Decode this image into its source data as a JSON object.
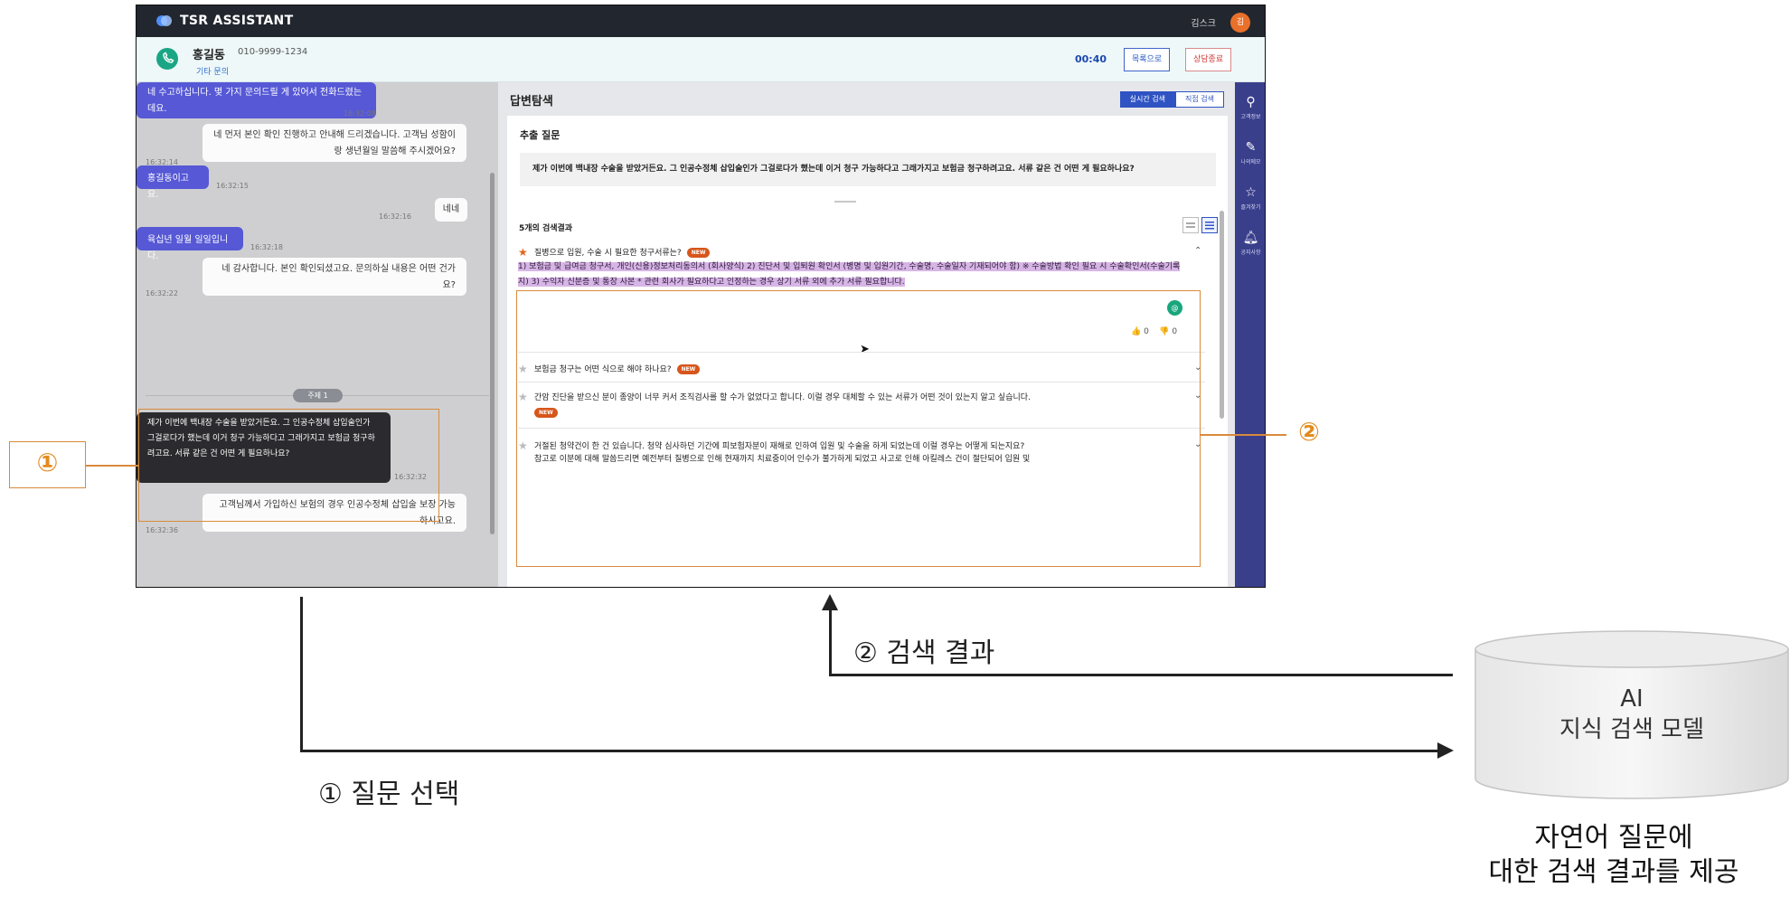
{
  "app": {
    "title": "TSR ASSISTANT",
    "user_name": "김스크",
    "avatar_initial": "김"
  },
  "call": {
    "customer_name": "홍길동",
    "phone": "010-9999-1234",
    "tag": "기타 문의",
    "timer": "00:40",
    "list_button": "목록으로",
    "end_button": "상담종료"
  },
  "chat": {
    "messages": [
      {
        "text": "네 수고하십니다. 몇 가지 문의드릴 게 있어서 전화드렸는데요.",
        "time": "16:32:08"
      },
      {
        "text": "네 먼저 본인 확인 진행하고 안내해 드리겠습니다. 고객님 성함이랑 생년월일 말씀해 주시겠어요?",
        "time": "16:32:14"
      },
      {
        "text": "홍길동이고요.",
        "time": "16:32:15"
      },
      {
        "text": "네네",
        "time": "16:32:16"
      },
      {
        "text": "육십년 일월 일일입니다.",
        "time": "16:32:18"
      },
      {
        "text": "네 감사합니다. 본인 확인되셨고요. 문의하실 내용은 어떤 건가요?",
        "time": "16:32:22"
      },
      {
        "text": "제가 이번에 백내장 수술을 받았거든요. 그 인공수정체 삽입술인가 그걸로다가 했는데 이거 청구 가능하다고 그래가지고 보험금 청구하려고요. 서류 같은 건 어떤 게 필요하나요?",
        "time": "16:32:32"
      },
      {
        "text": "고객님께서 가입하신 보험의 경우 인공수정체 삽입술 보장 가능하시고요.",
        "time": "16:32:36"
      }
    ],
    "topic": "주제 1"
  },
  "search": {
    "title": "답변탐색",
    "tabs": [
      "실시간 검색",
      "직접 검색"
    ],
    "extracted_label": "추출 질문",
    "extracted_question": "제가 이번에 백내장 수술을 받았거든요. 그 인공수정체 삽입술인가 그걸로다가 했는데 이거 청구 가능하다고 그래가지고 보험금 청구하려고요. 서류 같은 건 어떤 게 필요하나요?",
    "result_count": "5개의 검색결과",
    "results": [
      {
        "title": "질병으로 입원, 수술 시 필요한 청구서류는?",
        "new": "NEW"
      },
      {
        "title": "보험금 청구는 어떤 식으로 해야 하나요?",
        "new": "NEW"
      },
      {
        "title": "간암 진단을 받으신 분이 종양이 너무 커서 조직검사를 할 수가 없었다고 합니다. 이럴 경우 대체할 수 있는 서류가 어떤 것이 있는지 알고 싶습니다.",
        "new": "NEW"
      },
      {
        "title": "거절된 청약건이 한 건 있습니다. 청약 심사하던 기간에 피보험자분이 재해로 인하여 입원 및 수술을 하게 되었는데 이럴 경우는 어떻게 되는지요?",
        "line2": "참고로 이분에 대해 말씀드리면 예전부터 질병으로 인해 현재까지 치료중이어 인수가 불가하게 되었고 사고로 인해 아킬레스 건이 절단되어 입원 및"
      }
    ],
    "answer": "1) 보험금 및 급여금 청구서, 개인(신용)정보처리동의서 (회사양식) 2) 진단서 및 입퇴원 확인서 (병명 및 입원기간, 수술명, 수술일자 기재되어야 함) ※ 수술방법 확인 필요 시 수술확인서(수술기록지) 3) 수익자 신분증 및 통장 사본 * 관련 회사가 필요하다고 인정하는 경우 상기 서류 외에 추가 서류 필요합니다.",
    "likes": "0",
    "dislikes": "0"
  },
  "sidebar": {
    "items": [
      "고객정보",
      "나의메모",
      "즐겨찾기",
      "공지사항"
    ]
  },
  "annotations": {
    "marker1": "①",
    "marker2": "②"
  },
  "flow": {
    "search_result_label": "② 검색 결과",
    "question_select_label": "① 질문 선택",
    "model_line1": "AI",
    "model_line2": "지식 검색 모델",
    "caption_line1": "자연어 질문에",
    "caption_line2": "대한 검색 결과를 제공"
  }
}
